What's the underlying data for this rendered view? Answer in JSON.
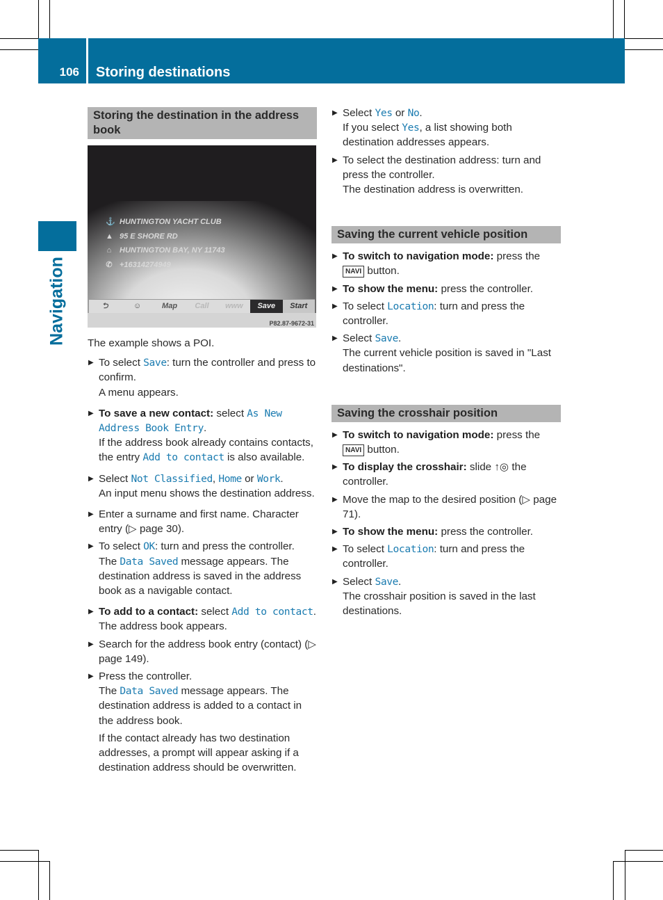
{
  "header": {
    "page_number": "106",
    "section_title": "Storing destinations",
    "side_tab_label": "Navigation",
    "accent_color": "#046e9c"
  },
  "left": {
    "section_title": "Storing the destination in the address book",
    "screenshot": {
      "rows": [
        {
          "icon": "poi-icon",
          "glyph": "⚓",
          "text": "HUNTINGTON YACHT CLUB"
        },
        {
          "icon": "street-icon",
          "glyph": "▲",
          "text": "95 E SHORE RD"
        },
        {
          "icon": "city-icon",
          "glyph": "⌂",
          "text": "HUNTINGTON BAY, NY 11743"
        },
        {
          "icon": "phone-icon",
          "glyph": "✆",
          "text": "+16314274949"
        }
      ],
      "menu": {
        "back": "⮌",
        "contacts": "☺",
        "map": "Map",
        "call": "Call",
        "www": "www",
        "save": "Save",
        "start": "Start"
      },
      "code": "P82.87-9672-31"
    },
    "intro": "The example shows a POI.",
    "steps": {
      "s1": {
        "a": "To select ",
        "ui": "Save",
        "b": ": turn the controller and press to confirm.",
        "c": "A menu appears."
      },
      "s2": {
        "bold": "To save a new contact:",
        "a": " select ",
        "ui": "As New Address Book Entry",
        "b": ".",
        "c1": "If the address book already contains contacts, the entry ",
        "ui2": "Add to contact",
        "c2": " is also available."
      },
      "s3": {
        "a": "Select ",
        "ui1": "Not Classified",
        "sep": ", ",
        "ui2": "Home",
        "or": " or ",
        "ui3": "Work",
        "b": ".",
        "c": "An input menu shows the destination address."
      },
      "s4": {
        "a": "Enter a surname and first name. Character entry (▷ page 30)."
      },
      "s5": {
        "a": "To select ",
        "ui": "OK",
        "b": ": turn and press the controller.",
        "c1": "The ",
        "ui2": "Data Saved",
        "c2": " message appears. The destination address is saved in the address book as a navigable contact."
      },
      "s6": {
        "bold": "To add to a contact:",
        "a": " select ",
        "ui": "Add to contact",
        "b": ".",
        "c": "The address book appears."
      },
      "s7": {
        "a": "Search for the address book entry (contact) (▷ page 149)."
      },
      "s8": {
        "a": "Press the controller.",
        "c1": "The ",
        "ui": "Data Saved",
        "c2": " message appears. The destination address is added to a contact in the address book.",
        "d": "If the contact already has two destination addresses, a prompt will appear asking if a destination address should be overwritten."
      }
    }
  },
  "right": {
    "steps_top": {
      "s1": {
        "a": "Select ",
        "ui1": "Yes",
        "or": " or ",
        "ui2": "No",
        "b": ".",
        "c1": "If you select ",
        "ui3": "Yes",
        "c2": ", a list showing both destination addresses appears."
      },
      "s2": {
        "a": "To select the destination address: turn and press the controller.",
        "c": "The destination address is overwritten."
      }
    },
    "vehicle": {
      "title": "Saving the current vehicle position",
      "s1": {
        "bold": "To switch to navigation mode:",
        "a": " press the ",
        "key": "NAVI",
        "b": " button."
      },
      "s2": {
        "bold": "To show the menu:",
        "a": " press the controller."
      },
      "s3": {
        "a": "To select ",
        "ui": "Location",
        "b": ": turn and press the controller."
      },
      "s4": {
        "a": "Select ",
        "ui": "Save",
        "b": ".",
        "c": "The current vehicle position is saved in \"Last destinations\"."
      }
    },
    "crosshair": {
      "title": "Saving the crosshair position",
      "s1": {
        "bold": "To switch to navigation mode:",
        "a": " press the ",
        "key": "NAVI",
        "b": " button."
      },
      "s2": {
        "bold": "To display the crosshair:",
        "a": " slide ",
        "sym": "↑◎",
        "b": " the controller."
      },
      "s3": {
        "a": "Move the map to the desired position (▷ page 71)."
      },
      "s4": {
        "bold": "To show the menu:",
        "a": " press the controller."
      },
      "s5": {
        "a": "To select ",
        "ui": "Location",
        "b": ": turn and press the controller."
      },
      "s6": {
        "a": "Select ",
        "ui": "Save",
        "b": ".",
        "c": "The crosshair position is saved in the last destinations."
      }
    }
  }
}
